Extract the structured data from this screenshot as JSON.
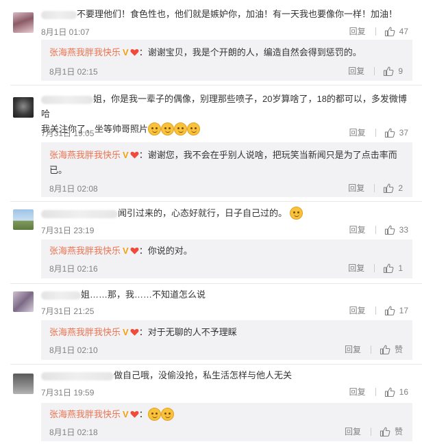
{
  "comments": [
    {
      "text": "不要理他们！食色性也，他们就是嫉妒你，加油！有一天我也要像你一样！加油！",
      "time": "8月1日 01:07",
      "reply_label": "回复",
      "likes": "47",
      "reply": {
        "author": "张海燕我胖我快乐",
        "text": "：谢谢宝贝，我是个开朗的人，编造自然会得到惩罚的。",
        "time": "8月1日 02:15",
        "reply_label": "回复",
        "likes": "9"
      }
    },
    {
      "text_a": "姐，你是我一辈子的偶像，别理那些喷子，20岁算啥了，18的都可以，多发微博哈",
      "text_b": "我关注你了，坐等帅哥照片",
      "time": "7月31日 19:05",
      "reply_label": "回复",
      "likes": "37",
      "reply": {
        "author": "张海燕我胖我快乐",
        "text": "：谢谢您，我不会在乎别人说啥，把玩笑当新闻只是为了点击率而已。",
        "time": "8月1日 02:08",
        "reply_label": "回复",
        "likes": "2"
      }
    },
    {
      "text": "闻引过来的，心态好就行，日子自己过的。",
      "time": "7月31日 23:19",
      "reply_label": "回复",
      "likes": "33",
      "reply": {
        "author": "张海燕我胖我快乐",
        "text": "：你说的对。",
        "time": "8月1日 02:16",
        "reply_label": "回复",
        "likes": "1"
      }
    },
    {
      "text": "姐……那，我……不知道怎么说",
      "time": "7月31日 21:25",
      "reply_label": "回复",
      "likes": "17",
      "reply": {
        "author": "张海燕我胖我快乐",
        "text": "：对于无聊的人不予理睬",
        "time": "8月1日 02:10",
        "reply_label": "回复",
        "likes": "赞"
      }
    },
    {
      "text": "做自己哦，没偷没抢，私生活怎样与他人无关",
      "time": "7月31日 19:59",
      "reply_label": "回复",
      "likes": "16",
      "reply": {
        "author": "张海燕我胖我快乐",
        "text": "：",
        "time": "8月1日 02:18",
        "reply_label": "回复",
        "likes": "赞"
      }
    }
  ],
  "icons": {
    "like": "thumbs-up-icon",
    "verified": "verified-v-icon",
    "heart": "heart-icon",
    "emoji": "smile-emoji-icon"
  },
  "colors": {
    "username": "#eb7350",
    "reply_bg": "#f2f2f5",
    "meta": "#808080"
  }
}
